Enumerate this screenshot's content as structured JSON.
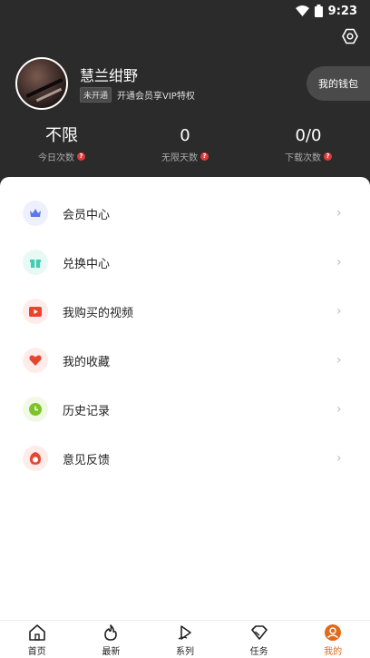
{
  "status_bar": {
    "time": "9:23"
  },
  "profile": {
    "username": "慧兰绀野",
    "vip_badge": "未开通",
    "vip_prompt": "开通会员享VIP特权",
    "wallet_label": "我的钱包"
  },
  "stats": [
    {
      "value": "不限",
      "label": "今日次数"
    },
    {
      "value": "0",
      "label": "无限天数"
    },
    {
      "value": "0/0",
      "label": "下载次数"
    }
  ],
  "menu": [
    {
      "label": "会员中心",
      "icon": "crown-icon",
      "color": "#5b78e8",
      "bg": "#eef1fd"
    },
    {
      "label": "兑换中心",
      "icon": "gift-icon",
      "color": "#3fcfb0",
      "bg": "#e8f9f5"
    },
    {
      "label": "我购买的视频",
      "icon": "video-play-icon",
      "color": "#e8452f",
      "bg": "#fdecea"
    },
    {
      "label": "我的收藏",
      "icon": "heart-icon",
      "color": "#e8452f",
      "bg": "#fdecea"
    },
    {
      "label": "历史记录",
      "icon": "clock-icon",
      "color": "#7dc42b",
      "bg": "#f1f9e6"
    },
    {
      "label": "意见反馈",
      "icon": "feedback-icon",
      "color": "#e8452f",
      "bg": "#fdecea"
    }
  ],
  "nav": [
    {
      "label": "首页",
      "icon": "home-icon"
    },
    {
      "label": "最新",
      "icon": "flame-icon"
    },
    {
      "label": "系列",
      "icon": "play-series-icon"
    },
    {
      "label": "任务",
      "icon": "diamond-icon"
    },
    {
      "label": "我的",
      "icon": "profile-icon",
      "active": true
    }
  ],
  "colors": {
    "accent": "#e06a1b",
    "header_bg": "#2b2b2b"
  }
}
